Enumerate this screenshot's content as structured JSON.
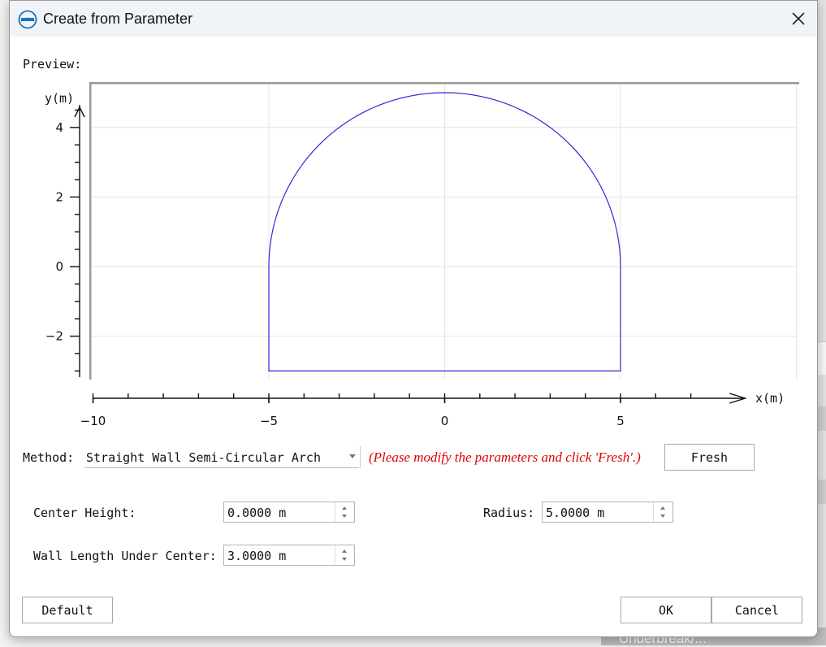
{
  "window": {
    "title": "Create from Parameter"
  },
  "background": {
    "text": "Underbreak/..."
  },
  "preview": {
    "label": "Preview:",
    "chart_data": {
      "type": "line",
      "xlabel": "x(m)",
      "ylabel": "y(m)",
      "xlim": [
        -10,
        10
      ],
      "ylim": [
        -3.2,
        5.05
      ],
      "x_ticks": [
        -10,
        -5,
        0,
        5
      ],
      "x_tick_labels": [
        "−10",
        "−5",
        "0",
        "5"
      ],
      "y_ticks": [
        -2,
        0,
        2,
        4
      ],
      "y_tick_labels": [
        "−2",
        "0",
        "2",
        "4"
      ],
      "grid": true,
      "series": [
        {
          "color": "#2b2bd6",
          "shape": "straight-wall semi-circular arch",
          "center": [
            0,
            0
          ],
          "radius": 5,
          "wall_bottom_y": -3
        }
      ]
    }
  },
  "method": {
    "label": "Method:",
    "selected": "Straight Wall Semi-Circular Arch",
    "hint": "(Please modify the parameters and click 'Fresh'.)",
    "fresh_label": "Fresh"
  },
  "params": {
    "center_height": {
      "label": "Center Height:",
      "value": "0.0000 m"
    },
    "radius": {
      "label": "Radius:",
      "value": "5.0000 m"
    },
    "wall_length": {
      "label": "Wall Length Under Center:",
      "value": "3.0000 m"
    }
  },
  "buttons": {
    "default_label": "Default",
    "ok_label": "OK",
    "cancel_label": "Cancel"
  }
}
